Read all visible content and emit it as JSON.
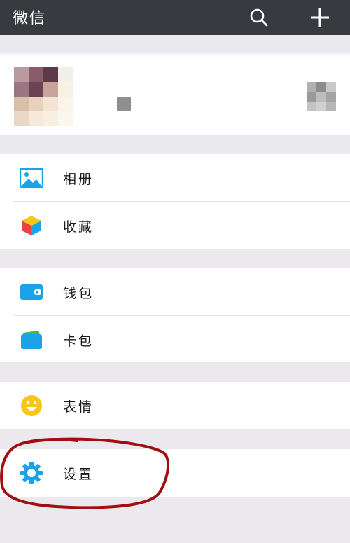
{
  "header": {
    "title": "微信",
    "search_icon": "search-icon",
    "add_icon": "plus-icon"
  },
  "profile": {
    "avatar": "avatar-pixelated",
    "qr_icon": "qr-code-icon"
  },
  "menu": {
    "album": {
      "label": "相册",
      "icon": "image-icon",
      "color": "#1aa3e8"
    },
    "favorites": {
      "label": "收藏",
      "icon": "cube-icon",
      "color": "#f5c518"
    },
    "wallet": {
      "label": "钱包",
      "icon": "wallet-icon",
      "color": "#1aa3e8"
    },
    "cards": {
      "label": "卡包",
      "icon": "card-icon",
      "color": "#1aa3e8"
    },
    "stickers": {
      "label": "表情",
      "icon": "smiley-icon",
      "color": "#f8c51c"
    },
    "settings": {
      "label": "设置",
      "icon": "gear-icon",
      "color": "#1aa3e8"
    }
  },
  "annotation": {
    "color": "#a01010"
  }
}
